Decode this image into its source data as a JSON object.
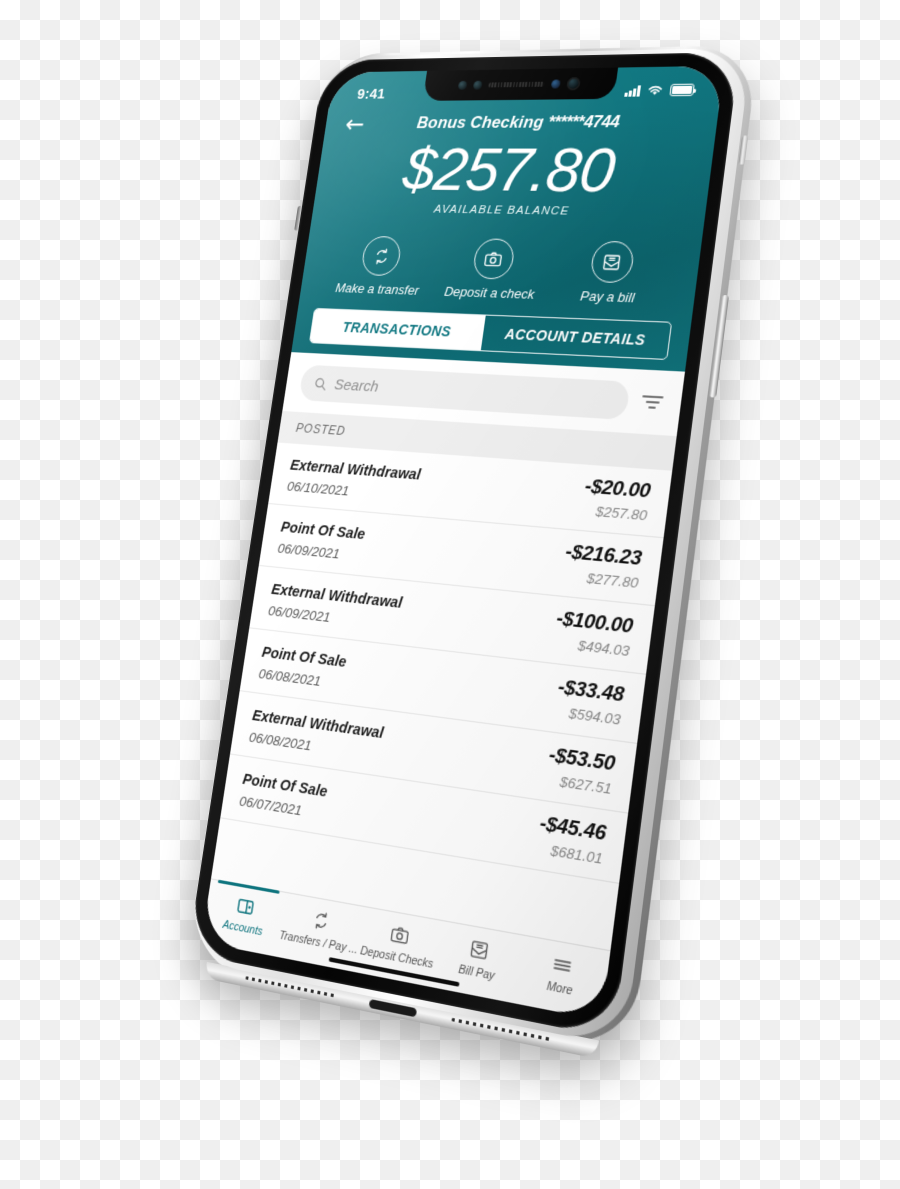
{
  "status_bar": {
    "time": "9:41",
    "signal_icon": "signal-bars-icon",
    "wifi_icon": "wifi-icon",
    "battery_icon": "battery-full-icon"
  },
  "header": {
    "back_icon": "back-arrow-icon",
    "account_name": "Bonus Checking",
    "account_mask": "******4744",
    "balance": "$257.80",
    "balance_label": "AVAILABLE BALANCE",
    "accent_color": "#0e7680",
    "actions": [
      {
        "label": "Make a transfer",
        "icon": "transfer-arrows-icon"
      },
      {
        "label": "Deposit a check",
        "icon": "camera-icon"
      },
      {
        "label": "Pay a bill",
        "icon": "bill-envelope-icon"
      }
    ],
    "tabs": [
      {
        "label": "TRANSACTIONS",
        "active": true
      },
      {
        "label": "ACCOUNT DETAILS",
        "active": false
      }
    ]
  },
  "search": {
    "placeholder": "Search",
    "value": "",
    "search_icon": "search-icon",
    "filter_icon": "filter-icon"
  },
  "transactions": {
    "section_label": "POSTED",
    "items": [
      {
        "description": "External Withdrawal",
        "date": "06/10/2021",
        "amount": "-$20.00",
        "balance": "$257.80"
      },
      {
        "description": "Point Of Sale",
        "date": "06/09/2021",
        "amount": "-$216.23",
        "balance": "$277.80"
      },
      {
        "description": "External Withdrawal",
        "date": "06/09/2021",
        "amount": "-$100.00",
        "balance": "$494.03"
      },
      {
        "description": "Point Of Sale",
        "date": "06/08/2021",
        "amount": "-$33.48",
        "balance": "$594.03"
      },
      {
        "description": "External Withdrawal",
        "date": "06/08/2021",
        "amount": "-$53.50",
        "balance": "$627.51"
      },
      {
        "description": "Point Of Sale",
        "date": "06/07/2021",
        "amount": "-$45.46",
        "balance": "$681.01"
      }
    ]
  },
  "tabbar": {
    "items": [
      {
        "label": "Accounts",
        "icon": "wallet-icon",
        "active": true
      },
      {
        "label": "Transfers / Pay ...",
        "icon": "transfer-arrows-icon",
        "active": false
      },
      {
        "label": "Deposit Checks",
        "icon": "camera-icon",
        "active": false
      },
      {
        "label": "Bill Pay",
        "icon": "bill-envelope-icon",
        "active": false
      },
      {
        "label": "More",
        "icon": "hamburger-icon",
        "active": false
      }
    ]
  }
}
